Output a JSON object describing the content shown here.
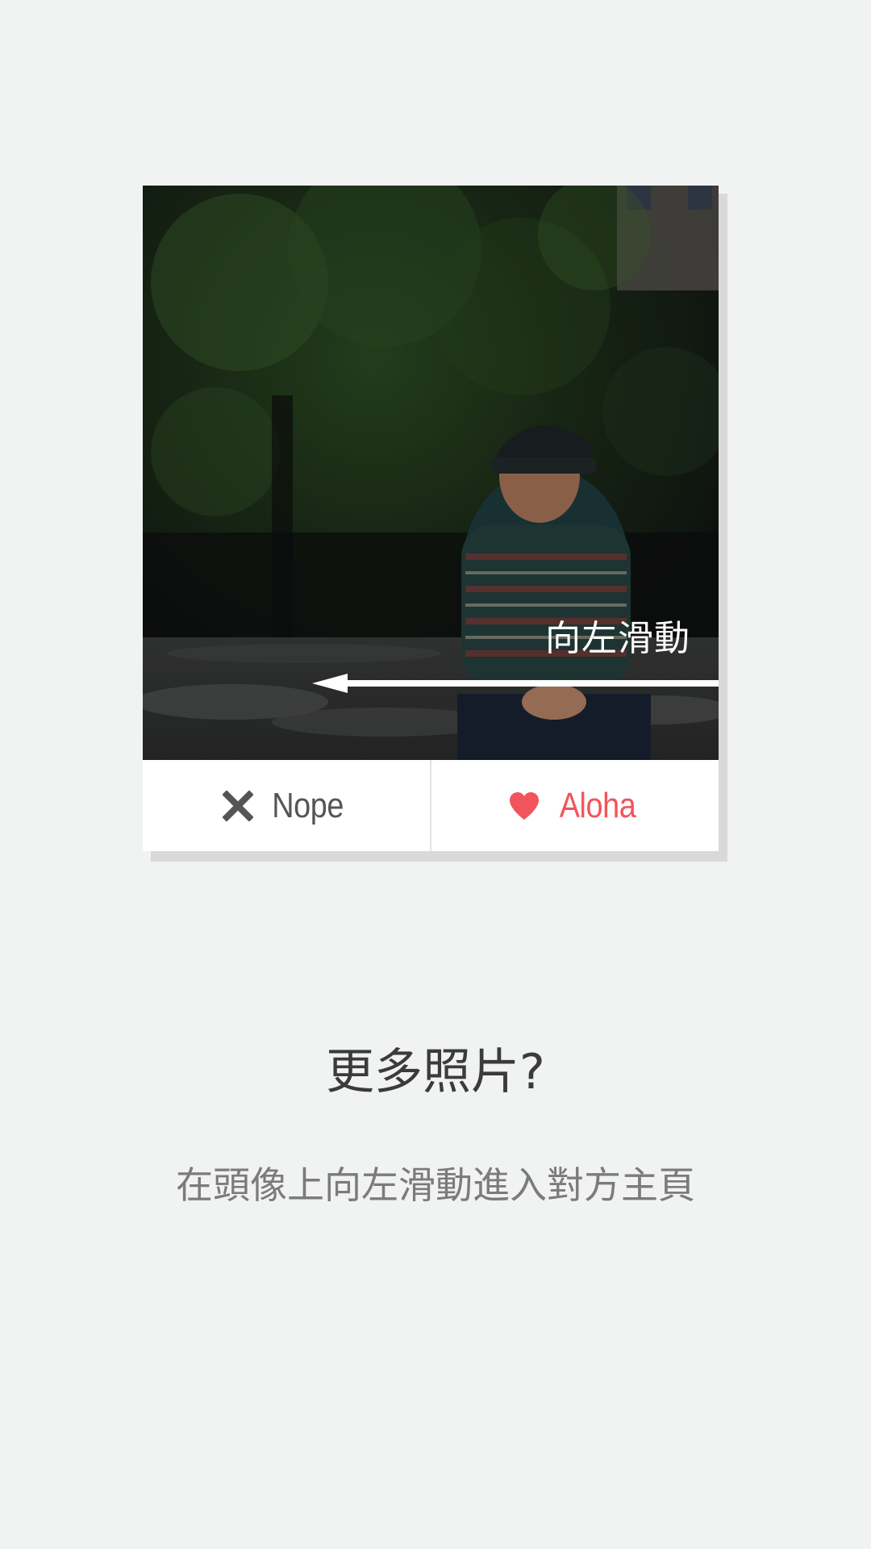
{
  "card": {
    "hint_text": "向左滑動",
    "nope_label": "Nope",
    "aloha_label": "Aloha",
    "nope_icon": "close-icon",
    "aloha_icon": "heart-icon",
    "aloha_color": "#f2545b",
    "nope_color": "#555555"
  },
  "onboarding": {
    "title": "更多照片?",
    "subtitle": "在頭像上向左滑動進入對方主頁"
  }
}
